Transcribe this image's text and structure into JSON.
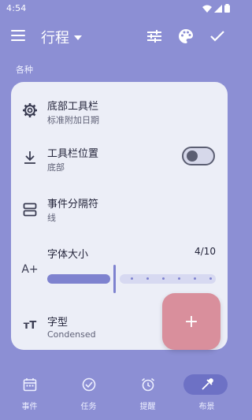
{
  "status": {
    "time": "4:54"
  },
  "app_bar": {
    "title": "行程"
  },
  "section": {
    "label": "各种"
  },
  "settings": [
    {
      "title": "底部工具栏",
      "subtitle": "标准附加日期",
      "icon": "gear-icon"
    },
    {
      "title": "工具栏位置",
      "subtitle": "底部",
      "icon": "download-icon",
      "toggle": false
    },
    {
      "title": "事件分隔符",
      "subtitle": "线",
      "icon": "separator-icon"
    },
    {
      "title": "字体大小",
      "subtitle": "",
      "icon": "text-size-icon",
      "value": "4/10",
      "fraction": 0.4
    },
    {
      "title": "字型",
      "subtitle": "Condensed",
      "icon": "font-icon"
    }
  ],
  "fab": {
    "label": "+"
  },
  "bottom_nav": [
    {
      "label": "事件",
      "icon": "calendar-icon",
      "active": false
    },
    {
      "label": "任务",
      "icon": "check-circle-icon",
      "active": false
    },
    {
      "label": "提醒",
      "icon": "alarm-icon",
      "active": false
    },
    {
      "label": "布景",
      "icon": "eyedropper-icon",
      "active": true
    }
  ],
  "colors": {
    "background": "#8c8fd4",
    "card": "#eceef7",
    "accent": "#7e82cf",
    "fab": "#d98f9c"
  }
}
